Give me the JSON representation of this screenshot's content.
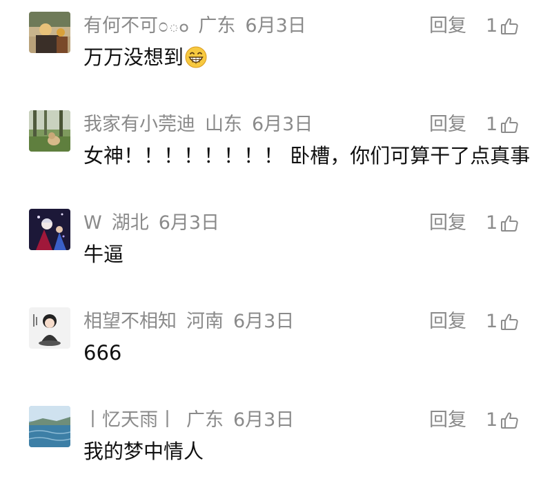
{
  "comments": [
    {
      "username": "有何不可೦ం",
      "location": "广东",
      "date": "6月3日",
      "reply_label": "回复",
      "likes": "1",
      "text": "万万没想到",
      "emoji": "grinning-face-emoji",
      "avatar": "photo-avatar-person-outdoors"
    },
    {
      "username": "我家有小莞迪",
      "location": "山东",
      "date": "6月3日",
      "reply_label": "回复",
      "likes": "1",
      "text": "女神！！！！！！！！ 卧槽，你们可算干了点真事",
      "avatar": "photo-avatar-dog-in-park"
    },
    {
      "username": "W",
      "location": "湖北",
      "date": "6月3日",
      "reply_label": "回复",
      "likes": "1",
      "text": "牛逼",
      "avatar": "anime-avatar-dark"
    },
    {
      "username": "相望不相知",
      "location": "河南",
      "date": "6月3日",
      "reply_label": "回复",
      "likes": "1",
      "text": "666",
      "avatar": "cartoon-avatar-sitting-figure"
    },
    {
      "username": "丨忆天雨丨",
      "location": "广东",
      "date": "6月3日",
      "reply_label": "回复",
      "likes": "1",
      "text": "我的梦中情人",
      "avatar": "photo-avatar-seaside"
    }
  ],
  "colors": {
    "meta_gray": "#8a8a8a",
    "text_black": "#111111",
    "background": "#ffffff"
  },
  "icons": [
    "thumbs-up-icon",
    "grinning-face-emoji"
  ]
}
